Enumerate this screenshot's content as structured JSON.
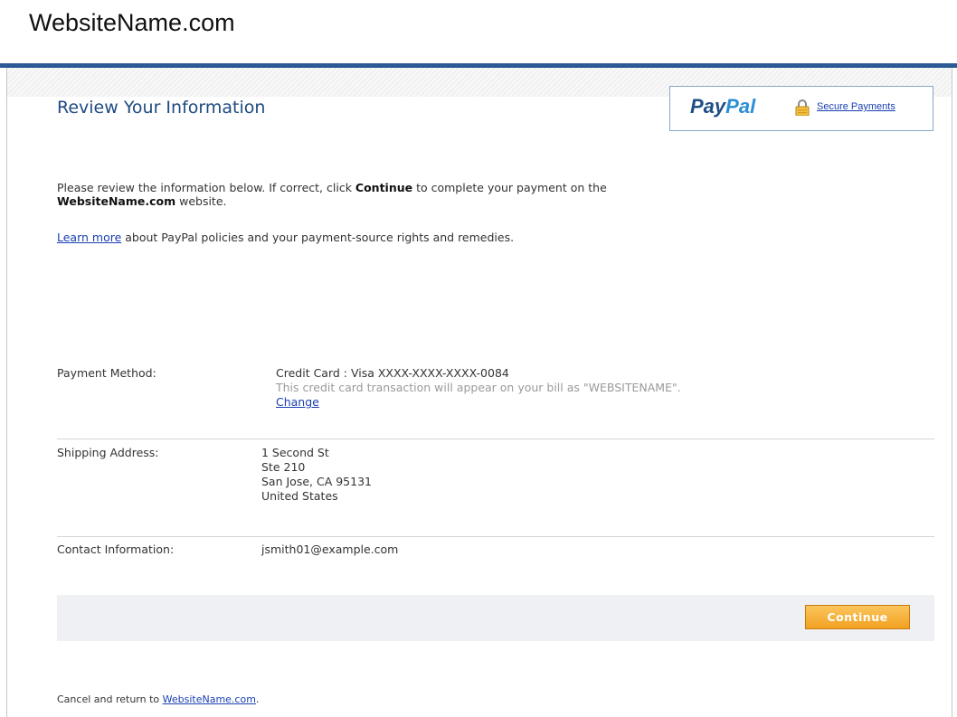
{
  "header": {
    "site_title": "WebsiteName.com"
  },
  "page": {
    "title": "Review Your Information"
  },
  "paypal_box": {
    "logo_pay": "Pay",
    "logo_pal": "Pal",
    "secure_link": "Secure Payments"
  },
  "intro": {
    "text_1": "Please review the information below. If correct, click ",
    "continue_word": "Continue",
    "text_2": " to complete your payment on the ",
    "site_name": "WebsiteName.com",
    "text_3": " website."
  },
  "learn_more": {
    "link": "Learn more",
    "text": " about PayPal policies and your payment-source rights and remedies."
  },
  "payment": {
    "label": "Payment Method:",
    "value": "Credit Card : Visa XXXX-XXXX-XXXX-0084",
    "note": "This credit card transaction will appear on your bill as \"WEBSITENAME\".",
    "change_link": "Change"
  },
  "shipping": {
    "label": "Shipping Address:",
    "lines": [
      "1 Second St",
      "Ste 210",
      "San Jose, CA 95131",
      "United States"
    ]
  },
  "contact": {
    "label": "Contact Information:",
    "value": "jsmith01@example.com"
  },
  "actions": {
    "continue_label": "Continue"
  },
  "cancel": {
    "text": "Cancel and return to ",
    "link": "WebsiteName.com",
    "suffix": "."
  },
  "colors": {
    "header_rule": "#2c5a96",
    "title": "#1f4a80",
    "link": "#1a3fb0",
    "button": "#f2a122",
    "action_bar": "#eef0f3"
  },
  "icons": {
    "lock": "lock-icon"
  }
}
